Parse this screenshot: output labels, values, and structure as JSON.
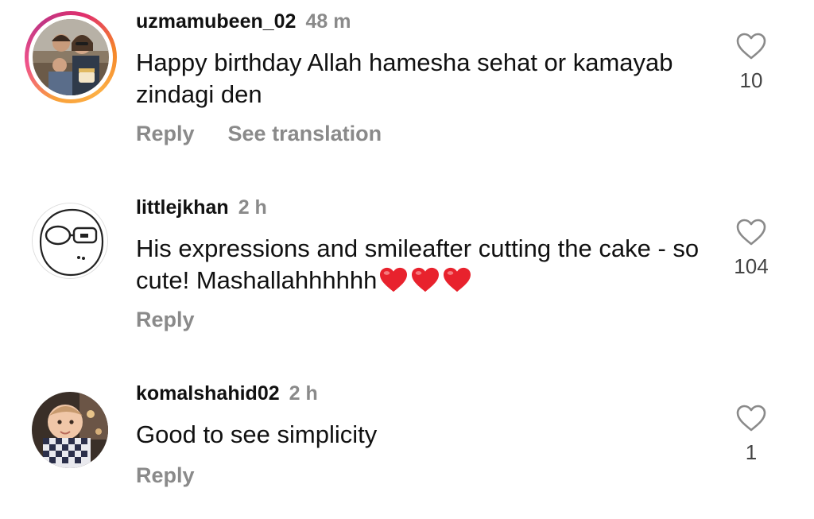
{
  "colors": {
    "muted": "#8a8a8a",
    "text": "#111111",
    "heart_emoji": "#e8222d"
  },
  "comments": [
    {
      "username": "uzmamubeen_02",
      "time": "48 m",
      "text": "Happy birthday Allah hamesha sehat or kamayab zindagi den",
      "likes": "10",
      "reply_label": "Reply",
      "translate_label": "See translation",
      "avatar": "family-photo",
      "has_story_ring": true
    },
    {
      "username": "littlejkhan",
      "time": "2 h",
      "text": "His expressions and smileafter cutting the cake - so cute! Mashallahhhhhh",
      "emojis": [
        "red-heart",
        "red-heart",
        "red-heart"
      ],
      "likes": "104",
      "reply_label": "Reply",
      "avatar": "meme-face-drawing"
    },
    {
      "username": "komalshahid02",
      "time": "2 h",
      "text": "Good to see simplicity",
      "likes": "1",
      "reply_label": "Reply",
      "avatar": "baby-photo"
    }
  ]
}
